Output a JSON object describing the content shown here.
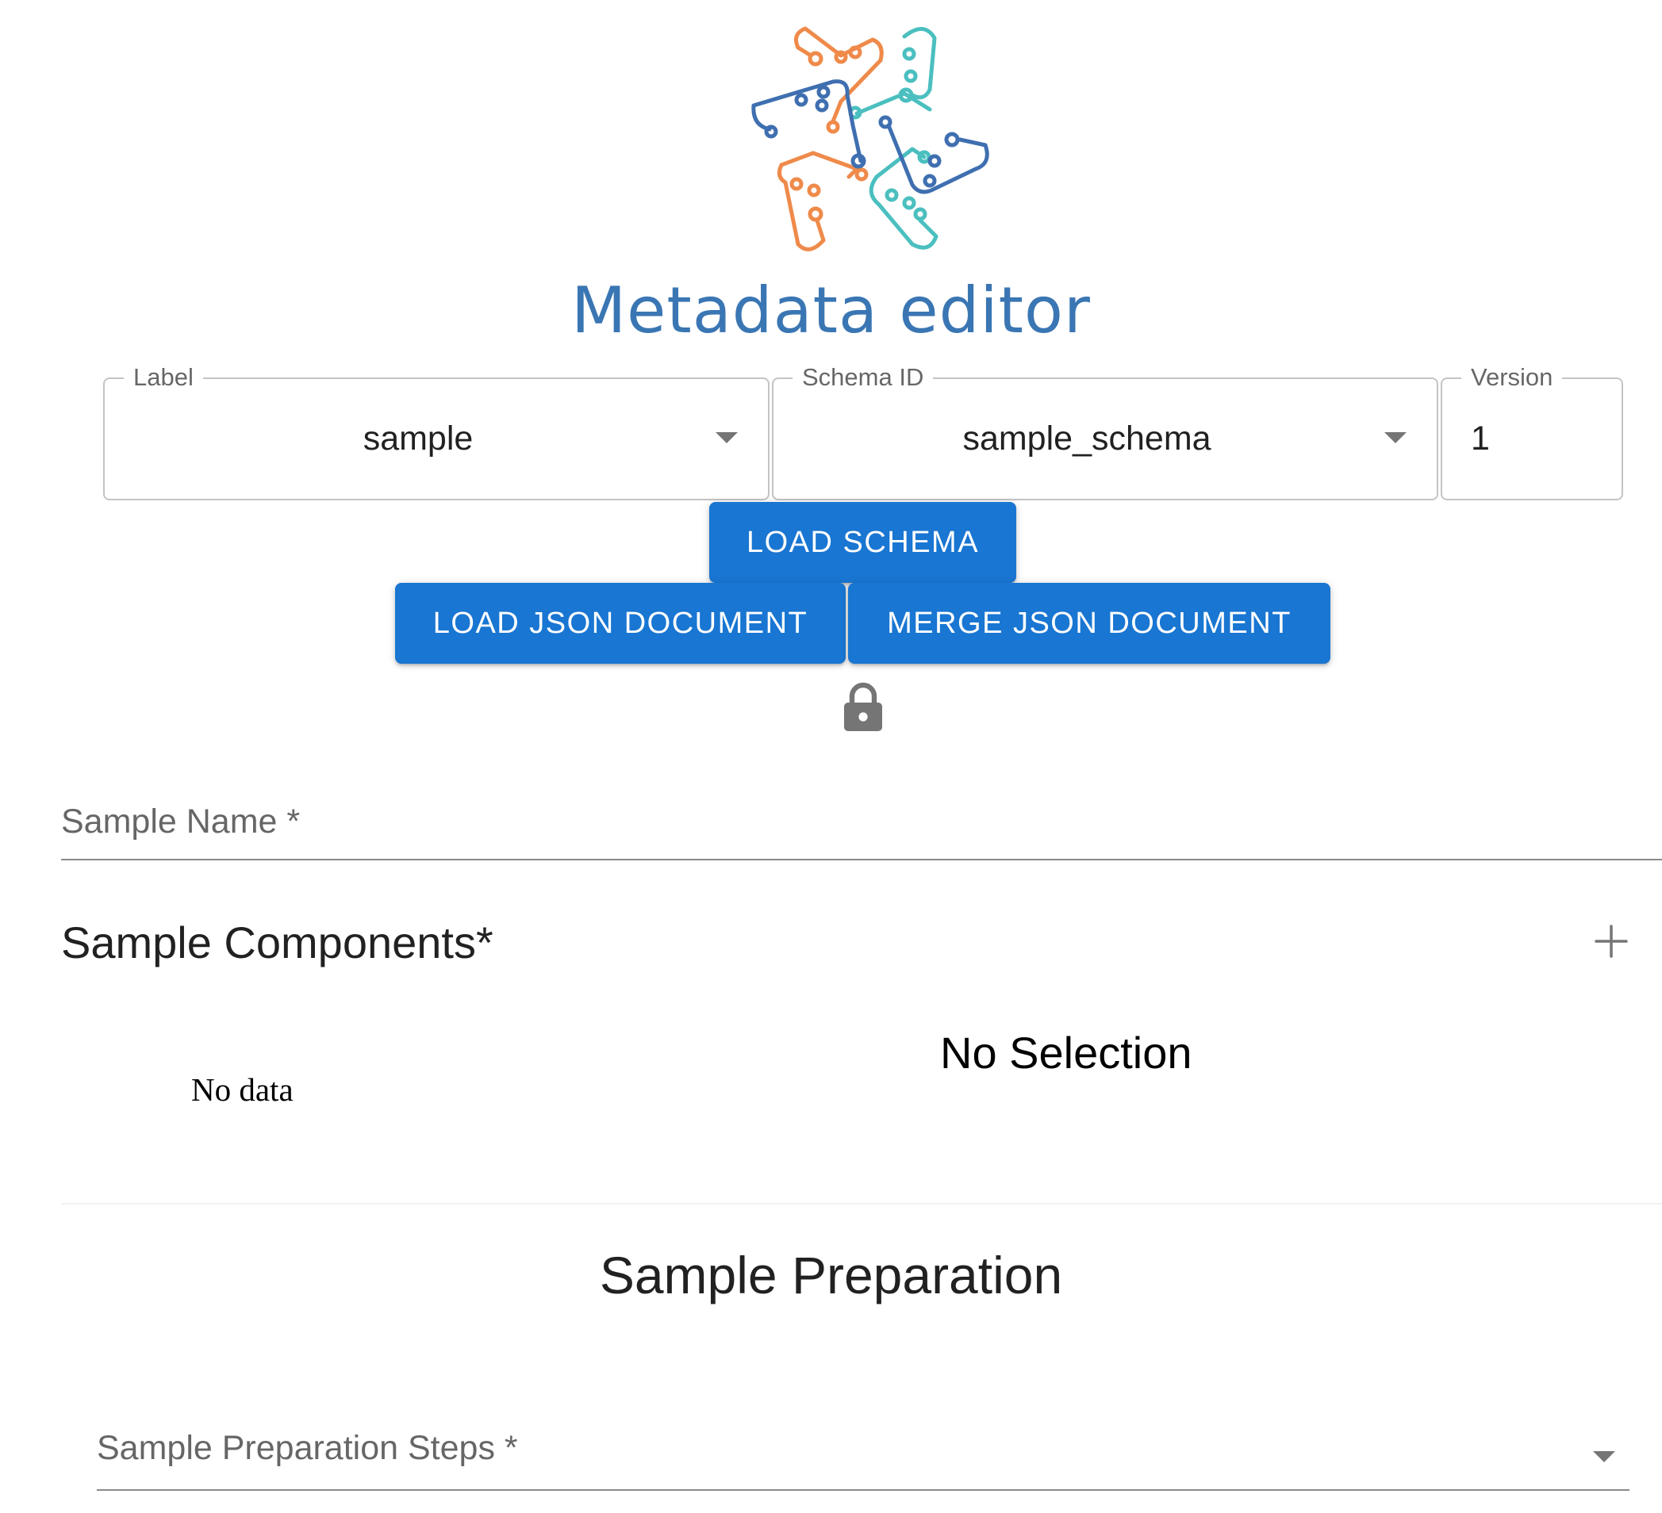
{
  "app": {
    "logo_text": "Metadata editor",
    "brand_color": "#3a76b3",
    "logo_colors": [
      "#ef8a4a",
      "#4bbfbf",
      "#3f6fb0"
    ]
  },
  "schema_selector": {
    "label_field": {
      "legend": "Label",
      "value": "sample"
    },
    "schema_id_field": {
      "legend": "Schema ID",
      "value": "sample_schema"
    },
    "version_field": {
      "legend": "Version",
      "value": "1"
    }
  },
  "actions": {
    "load_schema": "LOAD SCHEMA",
    "load_json": "LOAD JSON DOCUMENT",
    "merge_json": "MERGE JSON DOCUMENT",
    "accent": "#1976d2",
    "lock_icon": "lock-icon"
  },
  "form": {
    "sample_name": {
      "label": "Sample Name *"
    },
    "components": {
      "title": "Sample Components*",
      "add_icon": "plus-icon",
      "empty_list": "No data",
      "detail_placeholder": "No Selection"
    },
    "preparation": {
      "title": "Sample Preparation",
      "steps_label": "Sample Preparation Steps *"
    }
  }
}
